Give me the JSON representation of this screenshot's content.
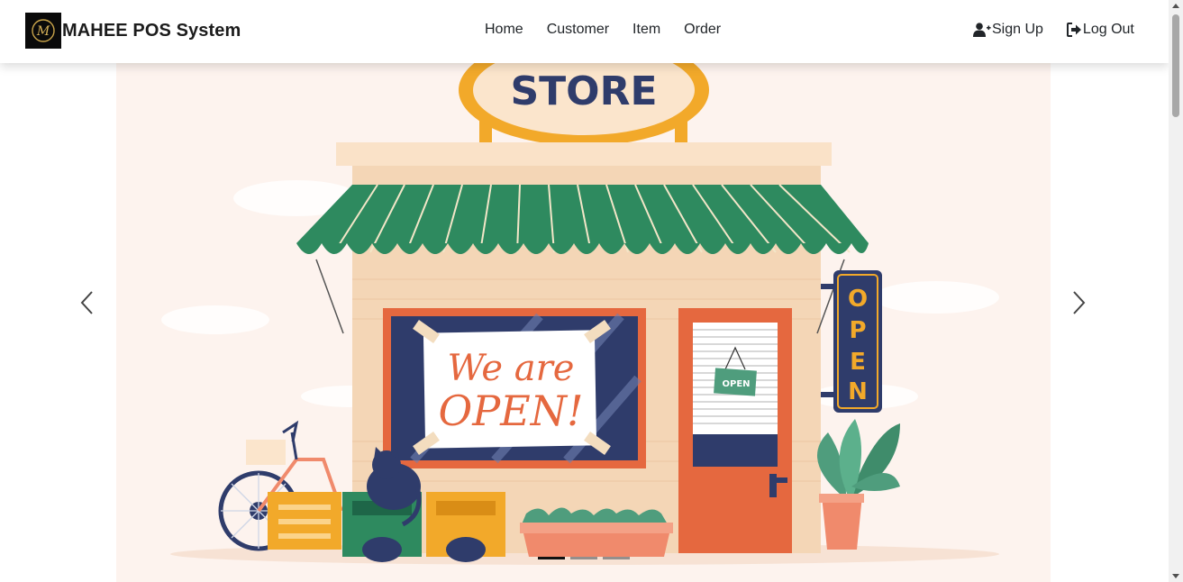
{
  "brand": {
    "name": "MAHEE POS System",
    "logo_letter": "M"
  },
  "nav": {
    "links": [
      {
        "label": "Home"
      },
      {
        "label": "Customer"
      },
      {
        "label": "Item"
      },
      {
        "label": "Order"
      }
    ],
    "signup_label": "Sign Up",
    "logout_label": "Log Out"
  },
  "carousel": {
    "slide": {
      "sign_text": "STORE",
      "window_line1": "We are",
      "window_line2": "OPEN!",
      "door_sign": "OPEN",
      "side_sign_letters": [
        "O",
        "P",
        "E",
        "N"
      ]
    },
    "indicator_count": 3,
    "active_index": 0
  },
  "colors": {
    "awning_green": "#2e8a5f",
    "sign_orange": "#f2a92a",
    "navy": "#2f3c6b",
    "door_orange": "#e5683f",
    "background": "#fdf3ee"
  }
}
